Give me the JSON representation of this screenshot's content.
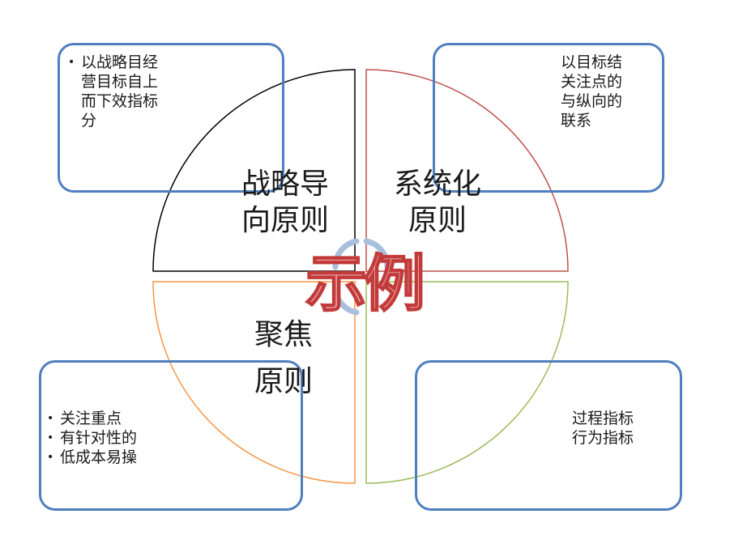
{
  "quadrants": {
    "top_left": {
      "lines": [
        "战略导",
        "向原则"
      ]
    },
    "top_right": {
      "lines": [
        "系统化",
        "原则"
      ]
    },
    "bottom_left": {
      "lines": [
        "聚焦",
        "原则"
      ]
    },
    "bottom_right": {
      "lines": []
    }
  },
  "boxes": {
    "top_left": {
      "bullets": [
        "以战略目经营目标自上而下效指标分"
      ]
    },
    "top_right": {
      "lines": [
        "以目标结",
        "关注点的",
        "与纵向的",
        "联系"
      ]
    },
    "bottom_left": {
      "bullets": [
        "关注重点",
        "有针对性的",
        "低成本易操"
      ]
    },
    "bottom_right": {
      "lines": [
        "过程指标",
        "行为指标"
      ]
    }
  },
  "watermark": "示例",
  "colors": {
    "box_border": "#4f7fbf",
    "quadrant_top_left": "#000000",
    "quadrant_top_right": "#c0504d",
    "quadrant_bottom_left": "#f79646",
    "quadrant_bottom_right": "#9bbb59",
    "center_circle": "#a8bfdd",
    "watermark_fill": "#e89292",
    "watermark_stroke": "#c23b3b"
  }
}
